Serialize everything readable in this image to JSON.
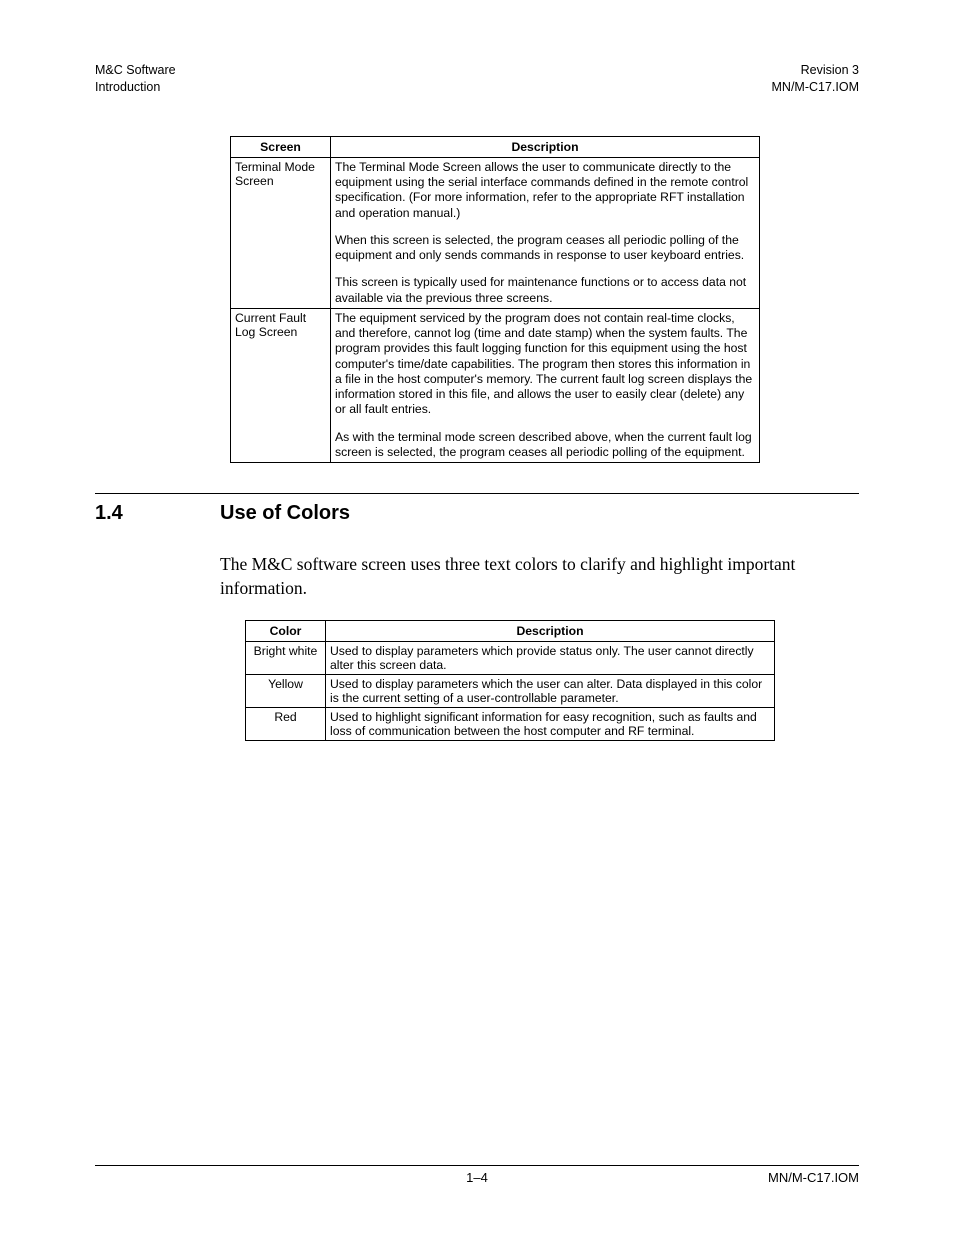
{
  "header": {
    "left_line1": "M&C Software",
    "left_line2": "Introduction",
    "right_line1": "Revision 3",
    "right_line2": "MN/M-C17.IOM"
  },
  "table1": {
    "col1_header": "Screen",
    "col2_header": "Description",
    "rows": [
      {
        "screen": "Terminal Mode Screen",
        "paras": [
          "The Terminal Mode Screen allows the user to communicate directly to the equipment using the serial interface commands defined in the remote control specification. (For more information, refer to the appropriate RFT installation and operation manual.)",
          "When this screen is selected, the program ceases all periodic polling of the equipment and only sends commands in response to user keyboard entries.",
          "This screen is typically used for maintenance functions or to access data not available via the previous three screens."
        ]
      },
      {
        "screen": "Current Fault Log Screen",
        "paras": [
          "The equipment serviced by the program does not contain real-time clocks, and therefore, cannot log (time and date stamp) when the system faults. The program provides this fault logging function for this equipment using the host computer's time/date capabilities. The program then stores this information in a file in the host computer's memory. The current fault log screen displays the information stored in this file, and allows the user to easily clear (delete) any or all fault entries.",
          "As with the terminal mode screen described above, when the current fault log screen is selected, the program ceases all periodic polling of the equipment."
        ]
      }
    ]
  },
  "section": {
    "number": "1.4",
    "title": "Use of Colors",
    "para": "The M&C software screen uses three text colors to clarify and highlight important information."
  },
  "table2": {
    "col1_header": "Color",
    "col2_header": "Description",
    "rows": [
      {
        "color": "Bright white",
        "desc": "Used to display parameters which provide status only. The user cannot directly alter this screen data."
      },
      {
        "color": "Yellow",
        "desc": "Used to display parameters which the user can alter. Data displayed in this color is the current setting of a user-controllable parameter."
      },
      {
        "color": "Red",
        "desc": "Used to highlight significant information for easy recognition, such as faults and loss of communication between the host computer and RF terminal."
      }
    ]
  },
  "footer": {
    "center": "1–4",
    "right": "MN/M-C17.IOM"
  }
}
